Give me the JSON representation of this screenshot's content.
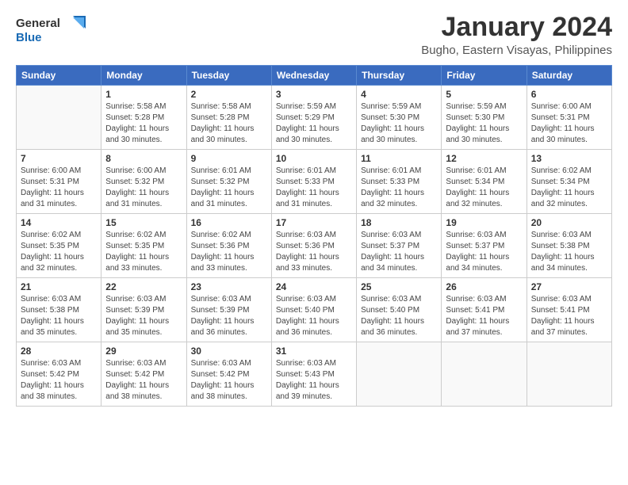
{
  "logo": {
    "line1": "General",
    "line2": "Blue"
  },
  "title": "January 2024",
  "location": "Bugho, Eastern Visayas, Philippines",
  "weekdays": [
    "Sunday",
    "Monday",
    "Tuesday",
    "Wednesday",
    "Thursday",
    "Friday",
    "Saturday"
  ],
  "weeks": [
    [
      {
        "day": "",
        "info": ""
      },
      {
        "day": "1",
        "info": "Sunrise: 5:58 AM\nSunset: 5:28 PM\nDaylight: 11 hours\nand 30 minutes."
      },
      {
        "day": "2",
        "info": "Sunrise: 5:58 AM\nSunset: 5:28 PM\nDaylight: 11 hours\nand 30 minutes."
      },
      {
        "day": "3",
        "info": "Sunrise: 5:59 AM\nSunset: 5:29 PM\nDaylight: 11 hours\nand 30 minutes."
      },
      {
        "day": "4",
        "info": "Sunrise: 5:59 AM\nSunset: 5:30 PM\nDaylight: 11 hours\nand 30 minutes."
      },
      {
        "day": "5",
        "info": "Sunrise: 5:59 AM\nSunset: 5:30 PM\nDaylight: 11 hours\nand 30 minutes."
      },
      {
        "day": "6",
        "info": "Sunrise: 6:00 AM\nSunset: 5:31 PM\nDaylight: 11 hours\nand 30 minutes."
      }
    ],
    [
      {
        "day": "7",
        "info": "Sunrise: 6:00 AM\nSunset: 5:31 PM\nDaylight: 11 hours\nand 31 minutes."
      },
      {
        "day": "8",
        "info": "Sunrise: 6:00 AM\nSunset: 5:32 PM\nDaylight: 11 hours\nand 31 minutes."
      },
      {
        "day": "9",
        "info": "Sunrise: 6:01 AM\nSunset: 5:32 PM\nDaylight: 11 hours\nand 31 minutes."
      },
      {
        "day": "10",
        "info": "Sunrise: 6:01 AM\nSunset: 5:33 PM\nDaylight: 11 hours\nand 31 minutes."
      },
      {
        "day": "11",
        "info": "Sunrise: 6:01 AM\nSunset: 5:33 PM\nDaylight: 11 hours\nand 32 minutes."
      },
      {
        "day": "12",
        "info": "Sunrise: 6:01 AM\nSunset: 5:34 PM\nDaylight: 11 hours\nand 32 minutes."
      },
      {
        "day": "13",
        "info": "Sunrise: 6:02 AM\nSunset: 5:34 PM\nDaylight: 11 hours\nand 32 minutes."
      }
    ],
    [
      {
        "day": "14",
        "info": "Sunrise: 6:02 AM\nSunset: 5:35 PM\nDaylight: 11 hours\nand 32 minutes."
      },
      {
        "day": "15",
        "info": "Sunrise: 6:02 AM\nSunset: 5:35 PM\nDaylight: 11 hours\nand 33 minutes."
      },
      {
        "day": "16",
        "info": "Sunrise: 6:02 AM\nSunset: 5:36 PM\nDaylight: 11 hours\nand 33 minutes."
      },
      {
        "day": "17",
        "info": "Sunrise: 6:03 AM\nSunset: 5:36 PM\nDaylight: 11 hours\nand 33 minutes."
      },
      {
        "day": "18",
        "info": "Sunrise: 6:03 AM\nSunset: 5:37 PM\nDaylight: 11 hours\nand 34 minutes."
      },
      {
        "day": "19",
        "info": "Sunrise: 6:03 AM\nSunset: 5:37 PM\nDaylight: 11 hours\nand 34 minutes."
      },
      {
        "day": "20",
        "info": "Sunrise: 6:03 AM\nSunset: 5:38 PM\nDaylight: 11 hours\nand 34 minutes."
      }
    ],
    [
      {
        "day": "21",
        "info": "Sunrise: 6:03 AM\nSunset: 5:38 PM\nDaylight: 11 hours\nand 35 minutes."
      },
      {
        "day": "22",
        "info": "Sunrise: 6:03 AM\nSunset: 5:39 PM\nDaylight: 11 hours\nand 35 minutes."
      },
      {
        "day": "23",
        "info": "Sunrise: 6:03 AM\nSunset: 5:39 PM\nDaylight: 11 hours\nand 36 minutes."
      },
      {
        "day": "24",
        "info": "Sunrise: 6:03 AM\nSunset: 5:40 PM\nDaylight: 11 hours\nand 36 minutes."
      },
      {
        "day": "25",
        "info": "Sunrise: 6:03 AM\nSunset: 5:40 PM\nDaylight: 11 hours\nand 36 minutes."
      },
      {
        "day": "26",
        "info": "Sunrise: 6:03 AM\nSunset: 5:41 PM\nDaylight: 11 hours\nand 37 minutes."
      },
      {
        "day": "27",
        "info": "Sunrise: 6:03 AM\nSunset: 5:41 PM\nDaylight: 11 hours\nand 37 minutes."
      }
    ],
    [
      {
        "day": "28",
        "info": "Sunrise: 6:03 AM\nSunset: 5:42 PM\nDaylight: 11 hours\nand 38 minutes."
      },
      {
        "day": "29",
        "info": "Sunrise: 6:03 AM\nSunset: 5:42 PM\nDaylight: 11 hours\nand 38 minutes."
      },
      {
        "day": "30",
        "info": "Sunrise: 6:03 AM\nSunset: 5:42 PM\nDaylight: 11 hours\nand 38 minutes."
      },
      {
        "day": "31",
        "info": "Sunrise: 6:03 AM\nSunset: 5:43 PM\nDaylight: 11 hours\nand 39 minutes."
      },
      {
        "day": "",
        "info": ""
      },
      {
        "day": "",
        "info": ""
      },
      {
        "day": "",
        "info": ""
      }
    ]
  ]
}
